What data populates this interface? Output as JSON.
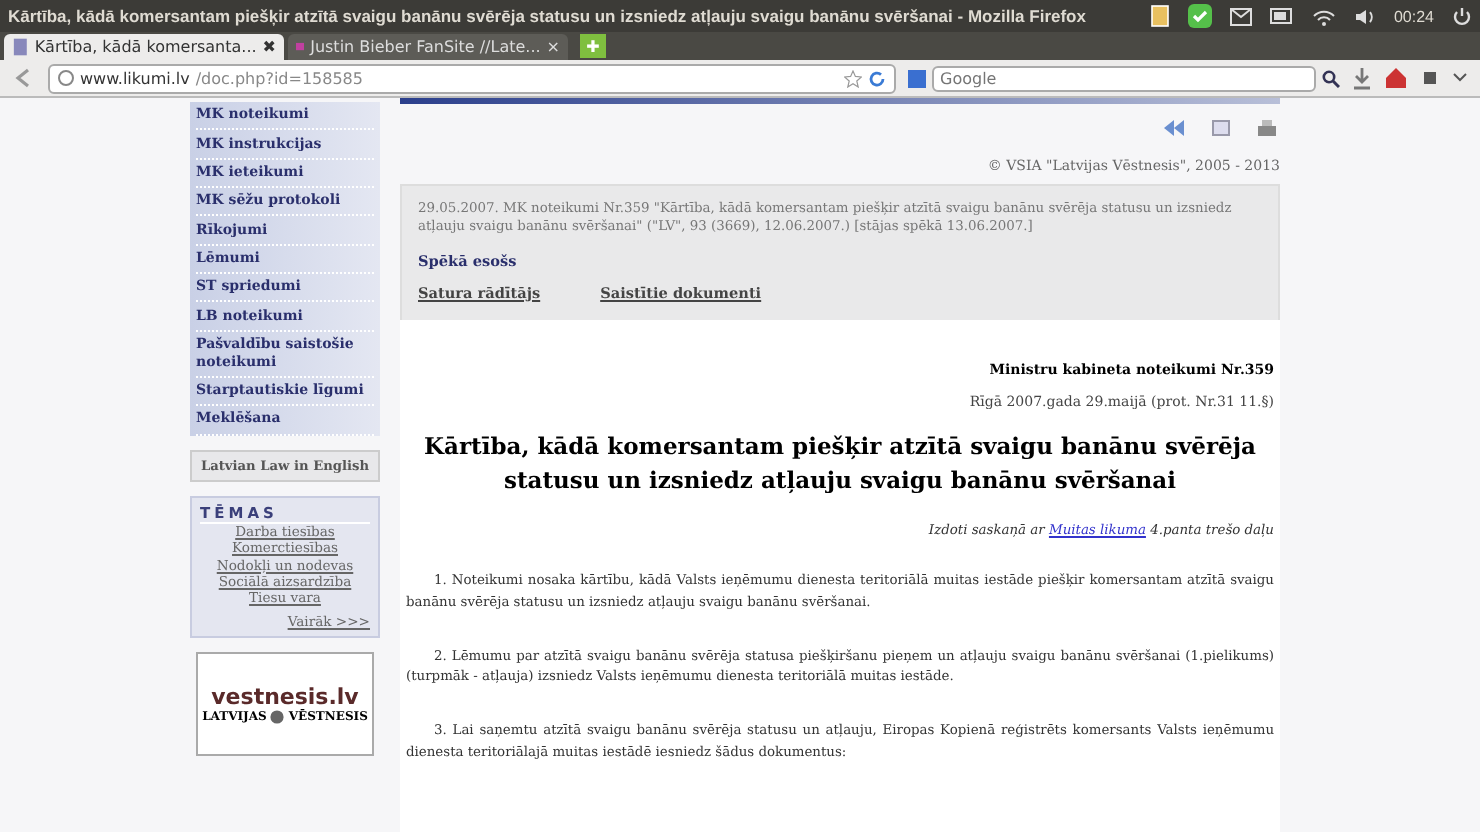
{
  "window": {
    "title": "Kārtība, kādā komersantam piešķir atzītā svaigu banānu svērēja statusu un izsniedz atļauju svaigu banānu svēršanai - Mozilla Firefox",
    "clock": "00:24"
  },
  "tabs": [
    {
      "label": "Kārtība, kādā komersanta...",
      "selected": true,
      "close": "✖"
    },
    {
      "label": "Justin Bieber FanSite //Late...",
      "selected": false,
      "close": "×"
    }
  ],
  "new_tab": "✚",
  "address_bar": {
    "domain": "www.likumi.lv",
    "path": "/doc.php?id=158585"
  },
  "search": {
    "placeholder": "Google"
  },
  "sidebar": {
    "items": [
      {
        "label": "MK noteikumi"
      },
      {
        "label": "MK instrukcijas"
      },
      {
        "label": "MK ieteikumi"
      },
      {
        "label": "MK sēžu protokoli"
      },
      {
        "label": "Rīkojumi"
      },
      {
        "label": "Lēmumi"
      },
      {
        "label": "ST spriedumi"
      },
      {
        "label": "LB noteikumi"
      },
      {
        "label": "Pašvaldību saistošie noteikumi"
      },
      {
        "label": "Starptautiskie līgumi"
      },
      {
        "label": "Meklēšana"
      }
    ],
    "english_button": "Latvian Law in English",
    "topics": {
      "title": "TĒMAS",
      "links": [
        "Darba tiesības",
        "Komerctiesības",
        "Nodokļi un nodevas",
        "Sociālā aizsardzība",
        "Tiesu vara"
      ],
      "more": "Vairāk >>>"
    },
    "logo": {
      "domain": "vestnesis.lv",
      "name_left": "LATVIJAS",
      "name_right": "VĒSTNESIS"
    }
  },
  "copyright": "© VSIA \"Latvijas Vēstnesis\", 2005 - 2013",
  "info_box": {
    "citation": "29.05.2007. MK noteikumi Nr.359 \"Kārtība, kādā komersantam piešķir atzītā svaigu banānu svērēja statusu un izsniedz atļauju svaigu banānu svēršanai\" (\"LV\", 93 (3669), 12.06.2007.) [stājas spēkā 13.06.2007.]",
    "status": "Spēkā esošs",
    "links": [
      "Satura rādītājs",
      "Saistītie dokumenti"
    ]
  },
  "document": {
    "issuer": "Ministru kabineta noteikumi Nr.359",
    "place_date": "Rīgā 2007.gada 29.maijā (prot. Nr.31 11.§)",
    "title": "Kārtība, kādā komersantam piešķir atzītā svaigu banānu svērēja statusu un izsniedz atļauju svaigu banānu svēršanai",
    "basis": {
      "before": "Izdoti saskaņā ar ",
      "link": "Muitas likuma",
      "after": " 4.panta trešo daļu"
    },
    "paragraphs": [
      "1. Noteikumi nosaka kārtību, kādā Valsts ieņēmumu dienesta teritoriālā muitas iestāde piešķir komersantam atzītā svaigu banānu svērēja statusu un izsniedz atļauju svaigu banānu svēršanai.",
      "2. Lēmumu par atzītā svaigu banānu svērēja statusa piešķiršanu pieņem un atļauju svaigu banānu svēršanai (1.pielikums) (turpmāk - atļauja) izsniedz Valsts ieņēmumu dienesta teritoriālā muitas iestāde.",
      "3. Lai saņemtu atzītā svaigu banānu svērēja statusu un atļauju, Eiropas Kopienā reģistrēts komersants Valsts ieņēmumu dienesta teritoriālajā muitas iestādē iesniedz šādus dokumentus:"
    ]
  }
}
